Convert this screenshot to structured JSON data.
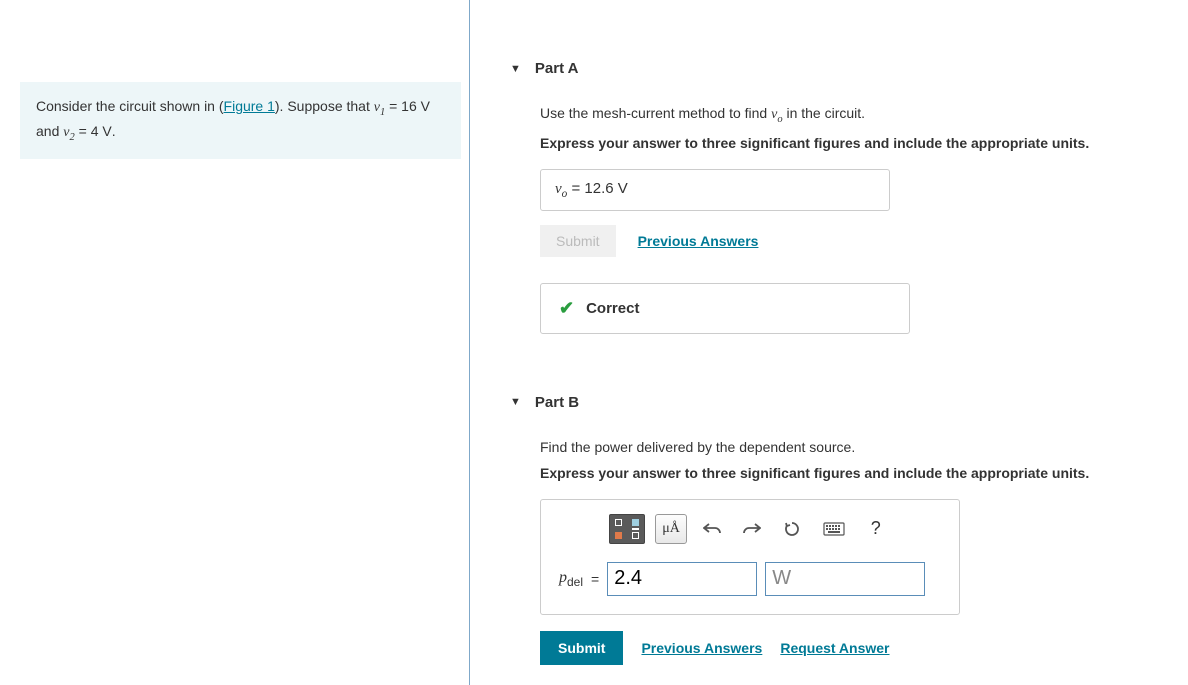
{
  "problem": {
    "intro_pre": "Consider the circuit shown in (",
    "figure_link": "Figure 1",
    "intro_post": "). Suppose that ",
    "v1_var": "v",
    "v1_sub": "1",
    "eq": " = ",
    "v1_val": "16",
    "unit_v": " V",
    "and": " and ",
    "v2_var": "v",
    "v2_sub": "2",
    "v2_val": "4",
    "period": "."
  },
  "partA": {
    "title": "Part A",
    "prompt_pre": "Use the mesh-current method to find ",
    "vo_var": "v",
    "vo_sub": "o",
    "prompt_post": " in the circuit.",
    "instruct": "Express your answer to three significant figures and include the appropriate units.",
    "answer_var": "v",
    "answer_sub": "o",
    "answer_eq": " = ",
    "answer_val": "12.6",
    "answer_unit": " V",
    "submit": "Submit",
    "prev": "Previous Answers",
    "correct": "Correct"
  },
  "partB": {
    "title": "Part B",
    "prompt": "Find the power delivered by the dependent source.",
    "instruct": "Express your answer to three significant figures and include the appropriate units.",
    "units_btn": "μÅ",
    "help_btn": "?",
    "var_html": "p",
    "var_sub": "del",
    "eq": " = ",
    "value": "2.4",
    "unit": "W",
    "submit": "Submit",
    "prev": "Previous Answers",
    "request": "Request Answer"
  }
}
